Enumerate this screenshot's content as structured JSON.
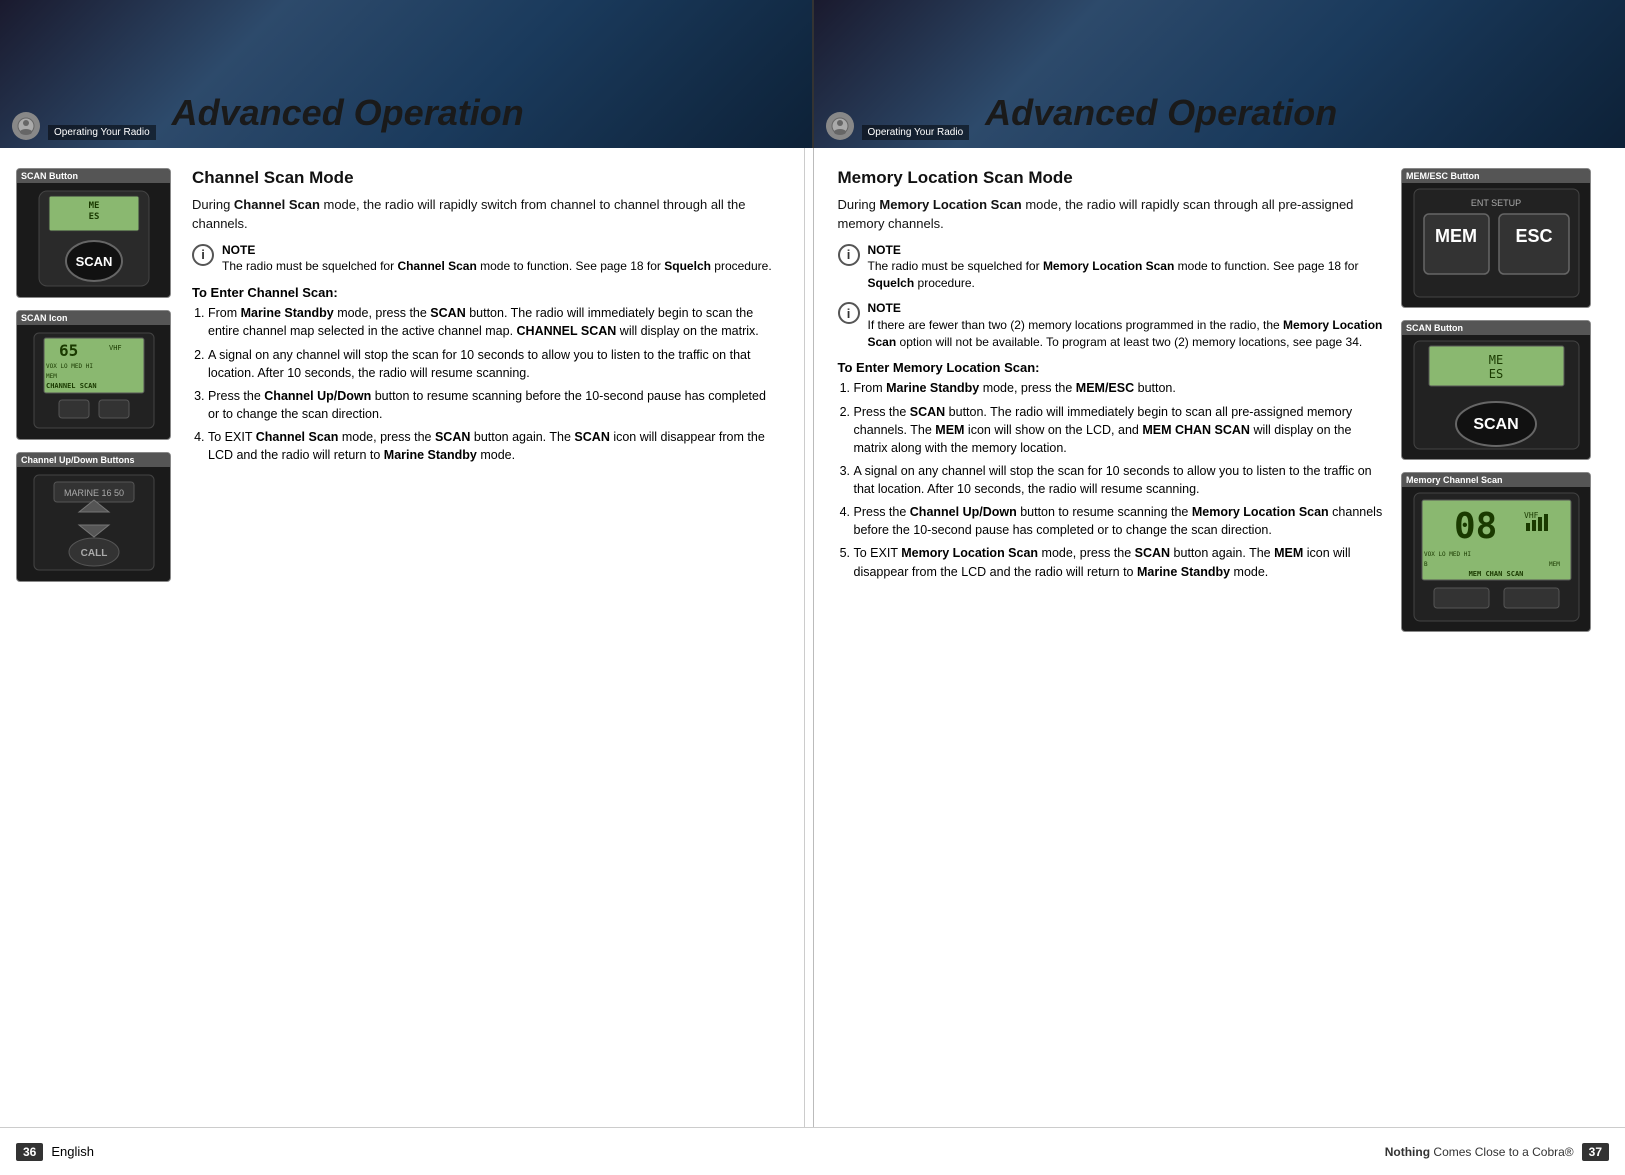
{
  "header": {
    "left_label": "Operating Your Radio",
    "right_label": "Operating Your Radio",
    "title_left": "Advanced Operation",
    "title_right": "Advanced Operation"
  },
  "left_page": {
    "section_title": "Channel Scan Mode",
    "intro": "During Channel Scan mode, the radio will rapidly switch from channel to channel through all the channels.",
    "note1": "The radio must be squelched for Channel Scan mode to function. See page 18 for Squelch procedure.",
    "steps_header": "To Enter Channel Scan:",
    "steps": [
      "From Marine Standby mode, press the SCAN button. The radio will immediately begin to scan the entire channel map selected in the active channel map. CHANNEL SCAN will display on the matrix.",
      "A signal on any channel will stop the scan for 10 seconds to allow you to listen to the traffic on that location. After 10 seconds, the radio will resume scanning.",
      "Press the Channel Up/Down button to resume scanning before the 10-second pause has completed or to change the scan direction.",
      "To EXIT Channel Scan mode, press the SCAN button again. The SCAN icon will disappear from the LCD and the radio will return to Marine Standby mode."
    ],
    "images": [
      {
        "label": "SCAN Button",
        "type": "scan_button"
      },
      {
        "label": "SCAN Icon",
        "type": "scan_icon"
      },
      {
        "label": "Channel Up/Down Buttons",
        "type": "channel_updown"
      }
    ]
  },
  "right_page": {
    "section_title": "Memory Location Scan Mode",
    "intro": "During Memory Location Scan mode, the radio will rapidly scan through all pre-assigned memory channels.",
    "note1": "The radio must be squelched for Memory Location Scan mode to function. See page 18 for Squelch procedure.",
    "note2": "If there are fewer than two (2) memory locations programmed in the radio, the Memory Location Scan option will not be available. To program at least two (2) memory locations, see page 34.",
    "steps_header": "To Enter Memory Location Scan:",
    "steps": [
      "From Marine Standby mode, press the MEM/ESC button.",
      "Press the SCAN button. The radio will immediately begin to scan all pre-assigned memory channels. The MEM icon will show on the LCD, and MEM CHAN SCAN will display on the matrix along with the memory location.",
      "A signal on any channel will stop the scan for 10 seconds to allow you to listen to the traffic on that location. After 10 seconds, the radio will resume scanning.",
      "Press the Channel Up/Down button to resume scanning the Memory Location Scan channels before the 10-second pause has completed or to change the scan direction.",
      "To EXIT Memory Location Scan mode, press the SCAN button again. The MEM icon will disappear from the LCD and the radio will return to Marine Standby mode."
    ],
    "images": [
      {
        "label": "MEM/ESC Button",
        "type": "mem_esc"
      },
      {
        "label": "SCAN Button",
        "type": "scan_button_right"
      },
      {
        "label": "Memory Channel Scan",
        "type": "mem_chan_scan"
      }
    ]
  },
  "footer": {
    "left_page_num": "36",
    "left_lang": "English",
    "right_brand": "Nothing Comes Close to a Cobra",
    "right_page_num": "37"
  }
}
